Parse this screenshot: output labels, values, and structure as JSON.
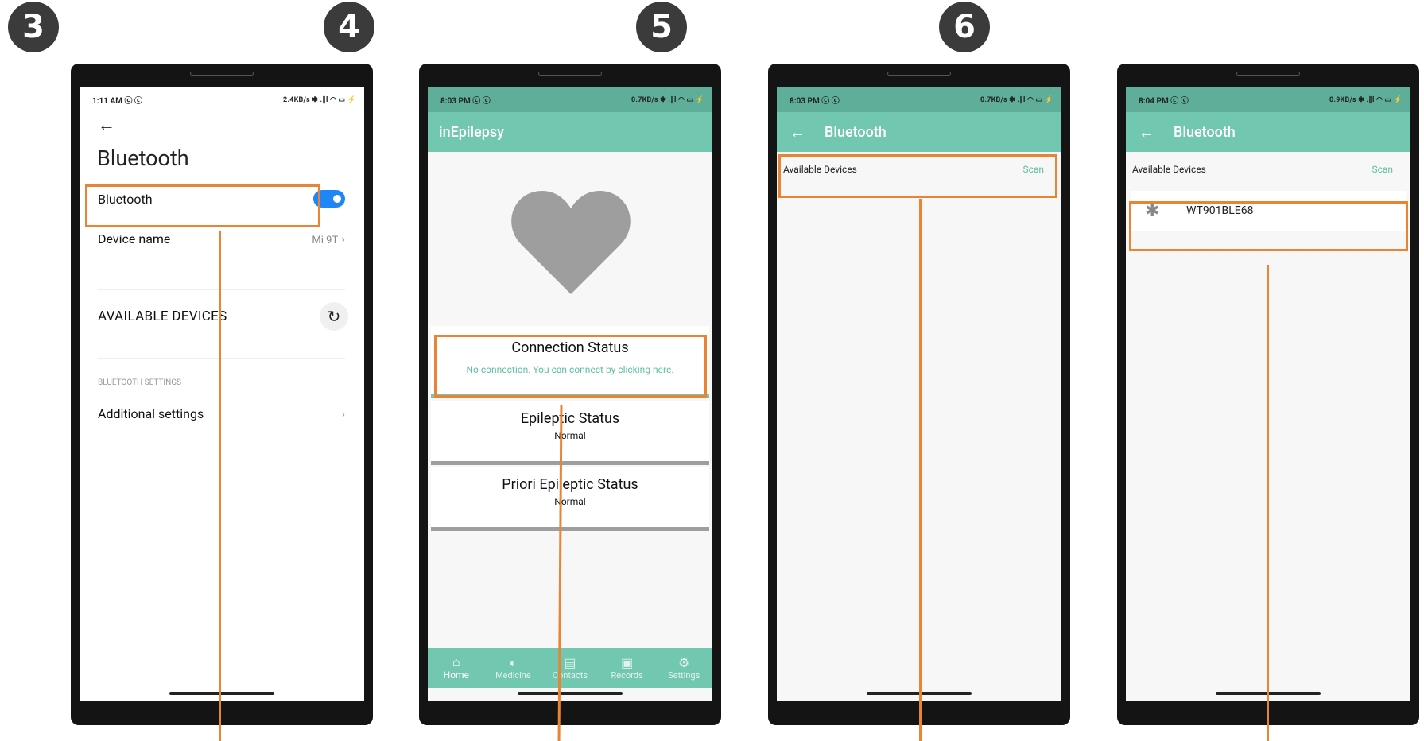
{
  "steps": [
    "3",
    "4",
    "5",
    "6"
  ],
  "colors": {
    "highlight": "#e98434",
    "teal": "#72c7b0",
    "teal_status": "#5fae99",
    "toggle_on": "#1f86f5"
  },
  "phone3": {
    "status": {
      "time": "1:11 AM",
      "icons_left": "ⓒ ⓒ",
      "right": "2.4KB/s ✱ .∥l ◠ ▭ ⚡"
    },
    "back_icon": "←",
    "title": "Bluetooth",
    "bluetooth_label": "Bluetooth",
    "device_name_label": "Device name",
    "device_name_value": "Mi 9T",
    "available_devices": "AVAILABLE DEVICES",
    "refresh_icon": "↻",
    "settings_section": "BLUETOOTH SETTINGS",
    "additional_settings": "Additional settings",
    "chevron": "›"
  },
  "phone4": {
    "status": {
      "time": "8:03 PM",
      "icons_left": "ⓒ ⓒ",
      "right": "0.7KB/s ✱ .∥l ◠ ▭ ⚡"
    },
    "app_title": "inEpilepsy",
    "heart_icon": "heart-icon",
    "connection_title": "Connection Status",
    "connection_text": "No connection. You can connect by clicking here.",
    "epileptic_title": "Epileptic Status",
    "epileptic_value": "Normal",
    "priori_title": "Priori Epileptic Status",
    "priori_value": "Normal",
    "tabs": [
      {
        "label": "Home",
        "icon": "⌂"
      },
      {
        "label": "Medicine",
        "icon": "◐"
      },
      {
        "label": "Contacts",
        "icon": "▤"
      },
      {
        "label": "Records",
        "icon": "▣"
      },
      {
        "label": "Settings",
        "icon": "⚙"
      }
    ]
  },
  "phone5": {
    "status": {
      "time": "8:03 PM",
      "icons_left": "ⓒ ⓒ",
      "right": "0.7KB/s ✱ .∥l ◠ ▭ ⚡"
    },
    "back_icon": "←",
    "title": "Bluetooth",
    "available_label": "Available Devices",
    "scan_label": "Scan"
  },
  "phone6": {
    "status": {
      "time": "8:04 PM",
      "icons_left": "ⓒ ⓒ",
      "right": "0.9KB/s ✱ .∥l ◠ ▭ ⚡"
    },
    "back_icon": "←",
    "title": "Bluetooth",
    "available_label": "Available Devices",
    "scan_label": "Scan",
    "bt_icon": "✱",
    "device": "WT901BLE68"
  }
}
